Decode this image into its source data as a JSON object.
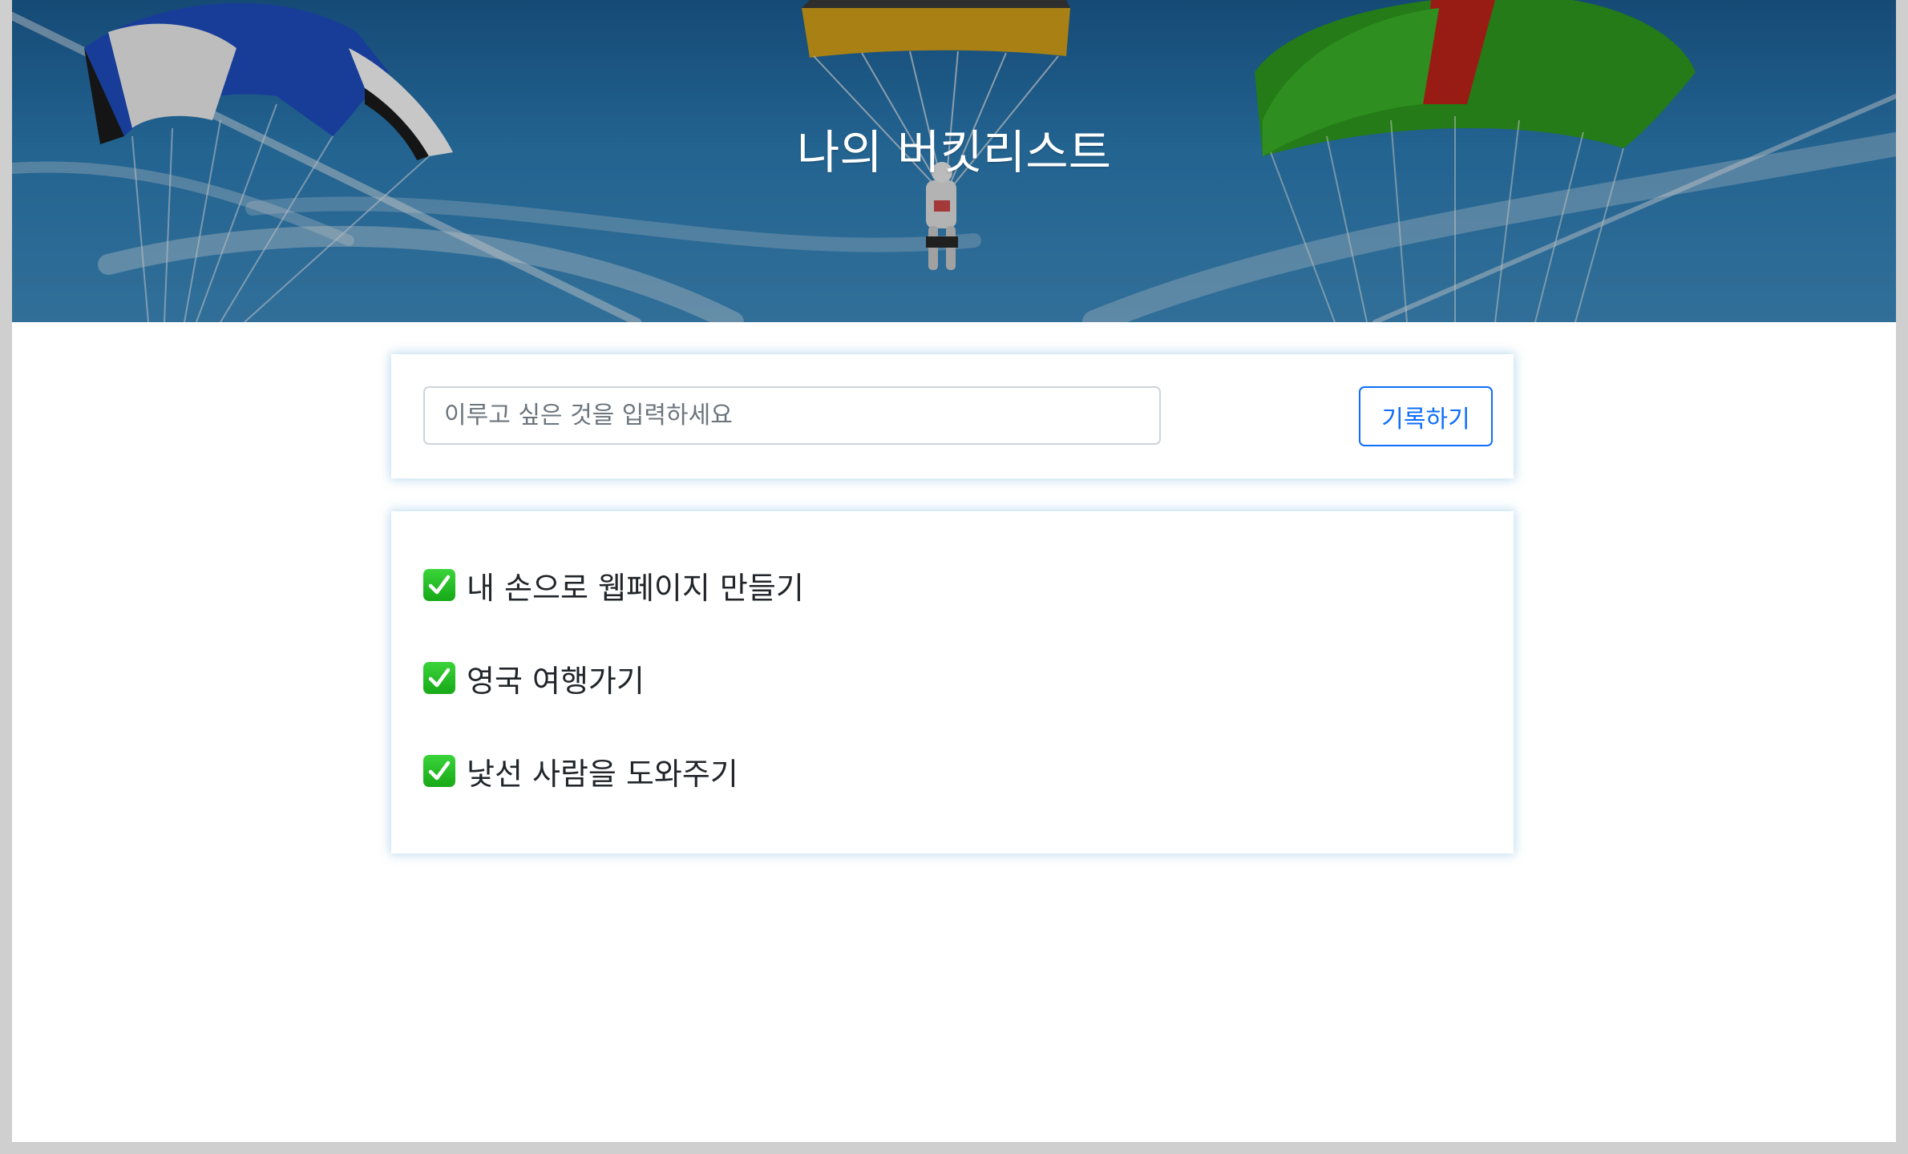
{
  "header": {
    "title": "나의 버킷리스트"
  },
  "form": {
    "input_placeholder": "이루고 싶은 것을 입력하세요",
    "input_value": "",
    "submit_label": "기록하기"
  },
  "bucket_list": {
    "items": [
      {
        "icon": "check-mark-icon",
        "text": "내 손으로 웹페이지 만들기",
        "done": true
      },
      {
        "icon": "check-mark-icon",
        "text": "영국 여행가기",
        "done": true
      },
      {
        "icon": "check-mark-icon",
        "text": "낯선 사람을 도와주기",
        "done": true
      }
    ]
  },
  "colors": {
    "accent": "#0d6efd",
    "check": "#22b422",
    "sky": "#2d7fb9"
  }
}
